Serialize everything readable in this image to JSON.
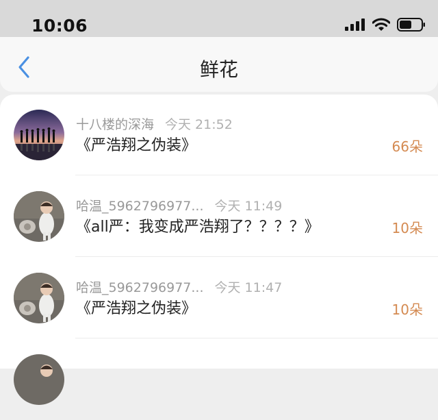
{
  "status_bar": {
    "time": "10:06",
    "icons": [
      "signal-icon",
      "wifi-icon",
      "battery-icon"
    ]
  },
  "header": {
    "title": "鲜花",
    "back_icon": "chevron-left-icon"
  },
  "colors": {
    "accent_orange": "#d48a51",
    "back_blue": "#4a90e2"
  },
  "items": [
    {
      "name": "十八楼的深海",
      "time": "今天 21:52",
      "title": "《严浩翔之伪装》",
      "count": "66朵"
    },
    {
      "name": "哈温_5962796977...",
      "time": "今天 11:49",
      "title": "《all严：我变成严浩翔了？？？？》",
      "count": "10朵"
    },
    {
      "name": "哈温_5962796977...",
      "time": "今天 11:47",
      "title": "《严浩翔之伪装》",
      "count": "10朵"
    }
  ]
}
